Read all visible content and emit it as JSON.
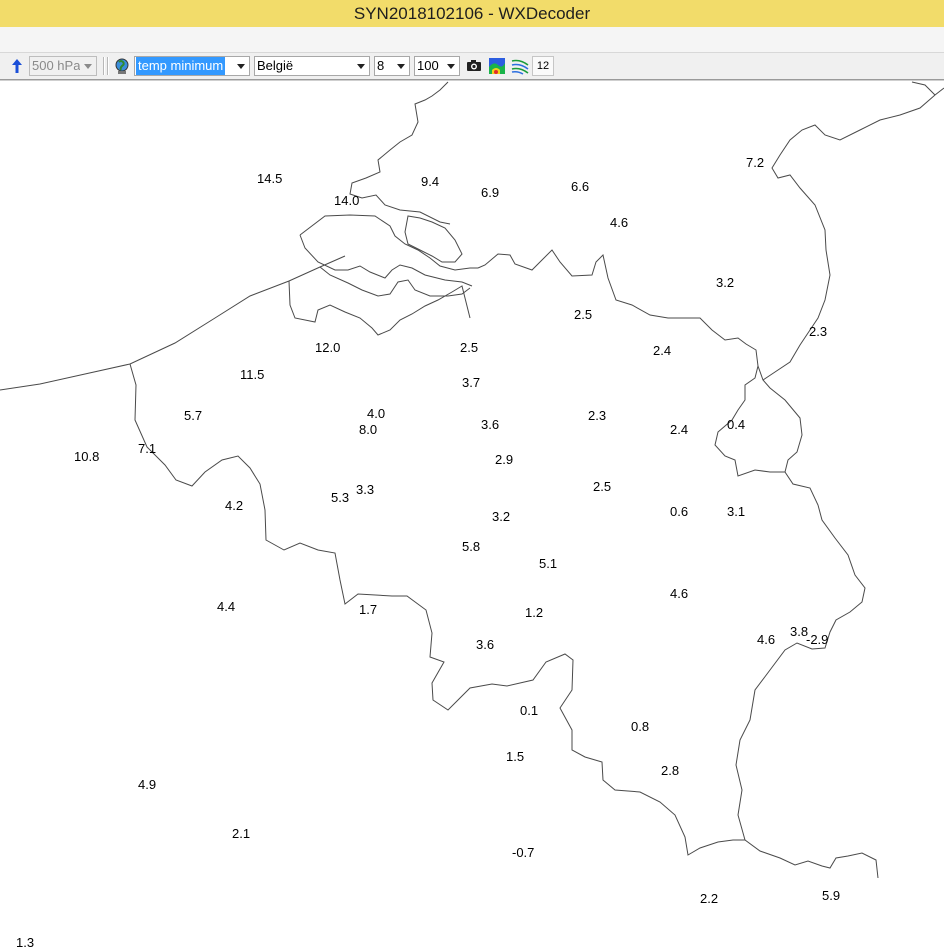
{
  "window": {
    "title": "SYN2018102106 - WXDecoder"
  },
  "toolbar": {
    "level": "500 hPa",
    "parameter": "temp minimum",
    "region": "België",
    "font_size": "8",
    "zoom": "100",
    "time_step": "12"
  },
  "colors": {
    "titlebar": "#f2dc6a",
    "selection": "#3399ff",
    "border_line": "#4a4a4a"
  },
  "icons": [
    "up-arrow-icon",
    "globe-icon",
    "camera-icon",
    "color-map-icon",
    "contour-lines-icon"
  ],
  "stations": [
    {
      "id": "s1",
      "value": "14.5"
    },
    {
      "id": "s2",
      "value": "9.4"
    },
    {
      "id": "s3",
      "value": "6.9"
    },
    {
      "id": "s4",
      "value": "6.6"
    },
    {
      "id": "s5",
      "value": "14.0"
    },
    {
      "id": "s6",
      "value": "4.6"
    },
    {
      "id": "s7",
      "value": "3.2"
    },
    {
      "id": "s8",
      "value": "2.5"
    },
    {
      "id": "s9",
      "value": "2.3"
    },
    {
      "id": "s10",
      "value": "12.0"
    },
    {
      "id": "s11",
      "value": "2.5"
    },
    {
      "id": "s12",
      "value": "2.4"
    },
    {
      "id": "s13",
      "value": "11.5"
    },
    {
      "id": "s14",
      "value": "3.7"
    },
    {
      "id": "s15",
      "value": "5.7"
    },
    {
      "id": "s16",
      "value": "4.0"
    },
    {
      "id": "s17",
      "value": "2.3"
    },
    {
      "id": "s18",
      "value": "8.0"
    },
    {
      "id": "s19",
      "value": "3.6"
    },
    {
      "id": "s20",
      "value": "2.4"
    },
    {
      "id": "s21",
      "value": "0.4"
    },
    {
      "id": "s22",
      "value": "7.1"
    },
    {
      "id": "s23",
      "value": "10.8"
    },
    {
      "id": "s24",
      "value": "2.9"
    },
    {
      "id": "s25",
      "value": "2.5"
    },
    {
      "id": "s26",
      "value": "5.3"
    },
    {
      "id": "s27",
      "value": "3.3"
    },
    {
      "id": "s28",
      "value": "4.2"
    },
    {
      "id": "s29",
      "value": "0.6"
    },
    {
      "id": "s30",
      "value": "3.1"
    },
    {
      "id": "s31",
      "value": "3.2"
    },
    {
      "id": "s32",
      "value": "5.8"
    },
    {
      "id": "s33",
      "value": "5.1"
    },
    {
      "id": "s34",
      "value": "4.6"
    },
    {
      "id": "s35",
      "value": "4.4"
    },
    {
      "id": "s36",
      "value": "1.7"
    },
    {
      "id": "s37",
      "value": "1.2"
    },
    {
      "id": "s38",
      "value": "3.8"
    },
    {
      "id": "s39",
      "value": "4.6"
    },
    {
      "id": "s40",
      "value": "-2.9"
    },
    {
      "id": "s41",
      "value": "3.6"
    },
    {
      "id": "s42",
      "value": "0.1"
    },
    {
      "id": "s43",
      "value": "0.8"
    },
    {
      "id": "s44",
      "value": "1.5"
    },
    {
      "id": "s45",
      "value": "2.8"
    },
    {
      "id": "s46",
      "value": "4.9"
    },
    {
      "id": "s47",
      "value": "2.1"
    },
    {
      "id": "s48",
      "value": "-0.7"
    },
    {
      "id": "s49",
      "value": "2.2"
    },
    {
      "id": "s50",
      "value": "5.9"
    },
    {
      "id": "s51",
      "value": "1.3"
    },
    {
      "id": "s52",
      "value": "7.2"
    }
  ]
}
